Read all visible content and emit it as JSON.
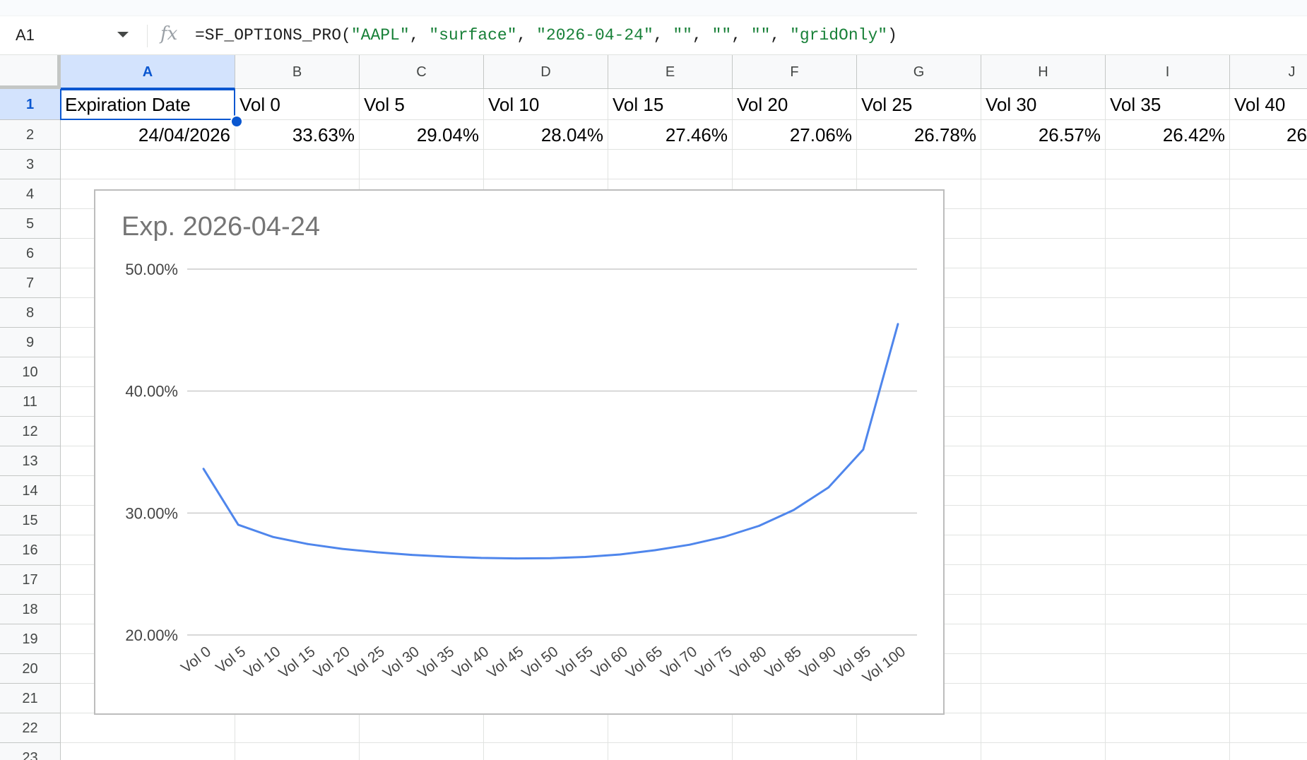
{
  "formula_bar": {
    "name_box": "A1",
    "fx_icon": "fx",
    "formula_parts": [
      {
        "text": "=SF_OPTIONS_PRO(",
        "kind": "code"
      },
      {
        "text": "\"AAPL\"",
        "kind": "str"
      },
      {
        "text": ", ",
        "kind": "code"
      },
      {
        "text": "\"surface\"",
        "kind": "str"
      },
      {
        "text": ", ",
        "kind": "code"
      },
      {
        "text": "\"2026-04-24\"",
        "kind": "str"
      },
      {
        "text": ", ",
        "kind": "code"
      },
      {
        "text": "\"\"",
        "kind": "str"
      },
      {
        "text": ", ",
        "kind": "code"
      },
      {
        "text": "\"\"",
        "kind": "str"
      },
      {
        "text": ", ",
        "kind": "code"
      },
      {
        "text": "\"\"",
        "kind": "str"
      },
      {
        "text": ", ",
        "kind": "code"
      },
      {
        "text": "\"gridOnly\"",
        "kind": "str"
      },
      {
        "text": ")",
        "kind": "code"
      }
    ]
  },
  "sheet": {
    "columns": [
      "A",
      "B",
      "C",
      "D",
      "E",
      "F",
      "G",
      "H",
      "I",
      "J"
    ],
    "rows": [
      "1",
      "2",
      "3",
      "4",
      "5",
      "6",
      "7",
      "8",
      "9",
      "10",
      "11",
      "12",
      "13",
      "14",
      "15",
      "16",
      "17",
      "18",
      "19",
      "20",
      "21",
      "22",
      "23"
    ],
    "selected_cell": "A1",
    "row1": [
      "Expiration Date",
      "Vol 0",
      "Vol 5",
      "Vol 10",
      "Vol 15",
      "Vol 20",
      "Vol 25",
      "Vol 30",
      "Vol 35",
      "Vol 40"
    ],
    "row2": [
      "24/04/2026",
      "33.63%",
      "29.04%",
      "28.04%",
      "27.46%",
      "27.06%",
      "26.78%",
      "26.57%",
      "26.42%",
      "26"
    ]
  },
  "chart_data": {
    "type": "line",
    "title": "Exp. 2026-04-24",
    "xlabel": "",
    "ylabel": "",
    "categories": [
      "Vol 0",
      "Vol 5",
      "Vol 10",
      "Vol 15",
      "Vol 20",
      "Vol 25",
      "Vol 30",
      "Vol 35",
      "Vol 40",
      "Vol 45",
      "Vol 50",
      "Vol 55",
      "Vol 60",
      "Vol 65",
      "Vol 70",
      "Vol 75",
      "Vol 80",
      "Vol 85",
      "Vol 90",
      "Vol 95",
      "Vol 100"
    ],
    "values": [
      33.63,
      29.04,
      28.04,
      27.46,
      27.06,
      26.78,
      26.57,
      26.42,
      26.32,
      26.28,
      26.3,
      26.4,
      26.6,
      26.95,
      27.4,
      28.05,
      28.95,
      30.25,
      32.1,
      35.2,
      45.5
    ],
    "ylim": [
      20,
      50
    ],
    "yticks": [
      "20.00%",
      "30.00%",
      "40.00%",
      "50.00%"
    ],
    "ytick_values": [
      20,
      30,
      40,
      50
    ],
    "grid": true,
    "legend": "none",
    "line_color": "#4f86ec"
  }
}
